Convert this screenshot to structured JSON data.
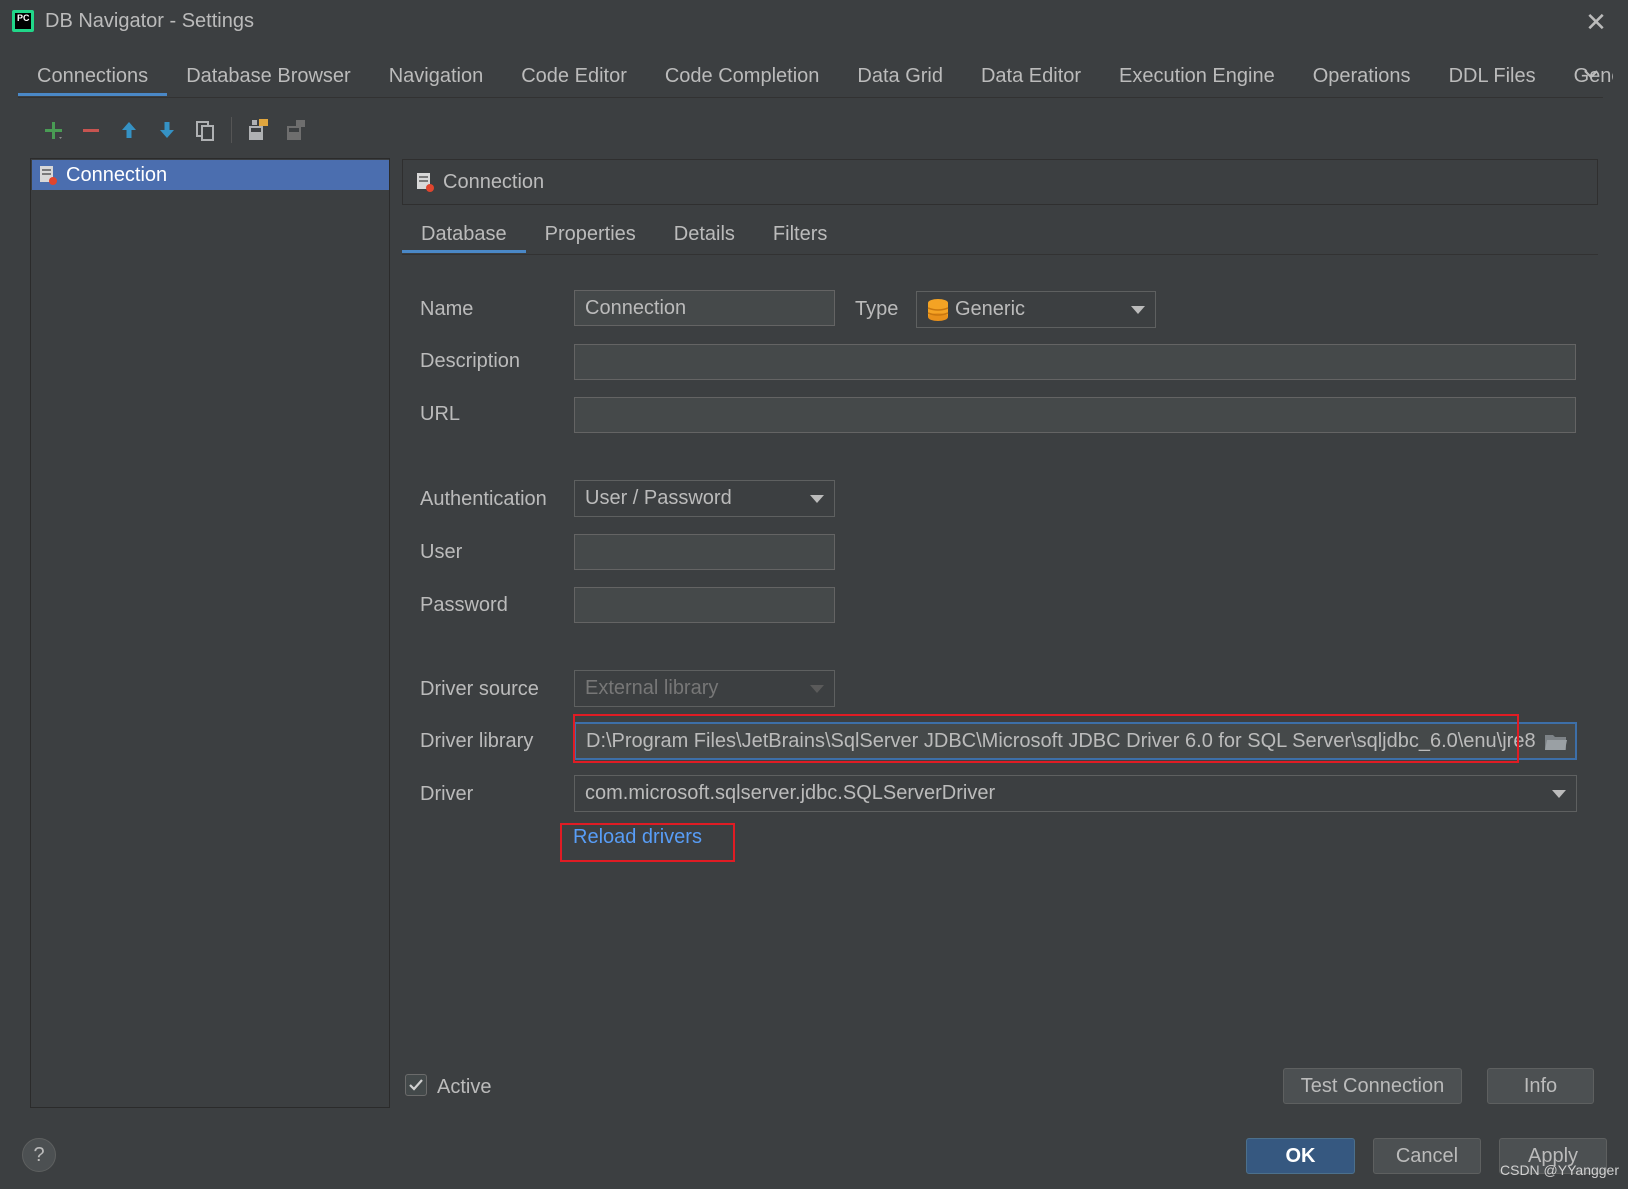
{
  "window": {
    "title": "DB Navigator - Settings",
    "app_icon_text": "PC",
    "close_icon": "close-icon"
  },
  "top_tabs": [
    {
      "label": "Connections",
      "active": true
    },
    {
      "label": "Database Browser"
    },
    {
      "label": "Navigation"
    },
    {
      "label": "Code Editor"
    },
    {
      "label": "Code Completion"
    },
    {
      "label": "Data Grid"
    },
    {
      "label": "Data Editor"
    },
    {
      "label": "Execution Engine"
    },
    {
      "label": "Operations"
    },
    {
      "label": "DDL Files"
    },
    {
      "label": "Gene"
    }
  ],
  "toolbar": {
    "icons": [
      "add-icon",
      "remove-icon",
      "move-up-icon",
      "move-down-icon",
      "copy-icon",
      "export-icon",
      "import-icon"
    ],
    "colors": {
      "add": "#499c54",
      "remove": "#c75450",
      "arrow": "#3592c4"
    }
  },
  "left_list": {
    "items": [
      {
        "label": "Connection",
        "selected": true
      }
    ]
  },
  "panel": {
    "title": "Connection",
    "sub_tabs": [
      {
        "label": "Database",
        "active": true
      },
      {
        "label": "Properties"
      },
      {
        "label": "Details"
      },
      {
        "label": "Filters"
      }
    ]
  },
  "form": {
    "name_label": "Name",
    "name_value": "Connection",
    "type_label": "Type",
    "type_value": "Generic",
    "description_label": "Description",
    "description_value": "",
    "url_label": "URL",
    "url_value": "",
    "authentication_label": "Authentication",
    "authentication_value": "User / Password",
    "user_label": "User",
    "user_value": "",
    "password_label": "Password",
    "password_value": "",
    "driver_source_label": "Driver source",
    "driver_source_value": "External library",
    "driver_library_label": "Driver library",
    "driver_library_value": "D:\\Program Files\\JetBrains\\SqlServer JDBC\\Microsoft JDBC Driver 6.0 for SQL Server\\sqljdbc_6.0\\enu\\jre8",
    "driver_label": "Driver",
    "driver_value": "com.microsoft.sqlserver.jdbc.SQLServerDriver",
    "reload_link": "Reload drivers"
  },
  "bottom": {
    "active_label": "Active",
    "active_checked": true,
    "test_connection": "Test Connection",
    "info": "Info",
    "ok": "OK",
    "cancel": "Cancel",
    "apply": "Apply",
    "help": "?"
  },
  "watermark": "CSDN @YYangger",
  "colors": {
    "background": "#3c3f41",
    "selection": "#4b6eaf",
    "link": "#589df6",
    "highlight_box": "#e01c24",
    "tab_underline": "#4a88c7"
  }
}
